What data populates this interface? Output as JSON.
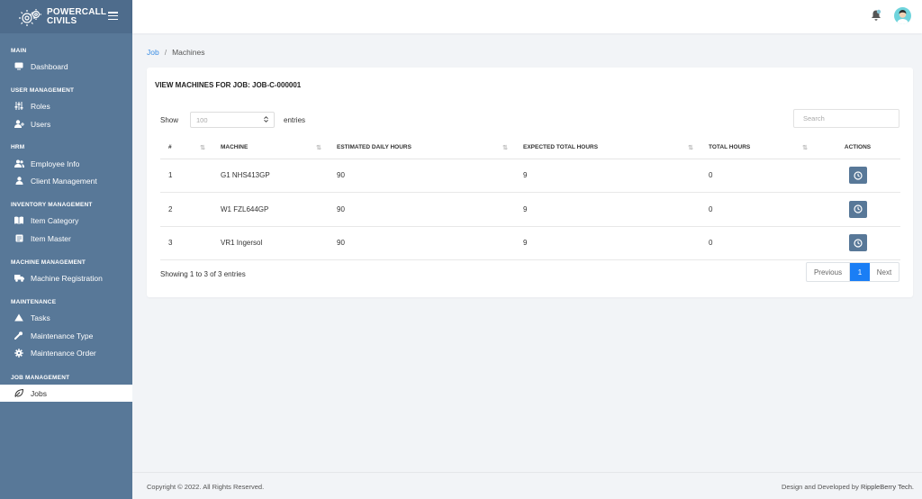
{
  "brand": {
    "line1": "POWERCALL",
    "line2": "CIVILS"
  },
  "sidebar": {
    "sections": [
      {
        "title": "MAIN",
        "items": [
          {
            "label": "Dashboard",
            "icon": "monitor-icon"
          }
        ]
      },
      {
        "title": "USER MANAGEMENT",
        "items": [
          {
            "label": "Roles",
            "icon": "sliders-icon"
          },
          {
            "label": "Users",
            "icon": "user-plus-icon"
          }
        ]
      },
      {
        "title": "HRM",
        "items": [
          {
            "label": "Employee Info",
            "icon": "users-icon"
          },
          {
            "label": "Client Management",
            "icon": "user-icon"
          }
        ]
      },
      {
        "title": "INVENTORY MANAGEMENT",
        "items": [
          {
            "label": "Item Category",
            "icon": "book-icon"
          },
          {
            "label": "Item Master",
            "icon": "list-icon"
          }
        ]
      },
      {
        "title": "MACHINE MANAGEMENT",
        "items": [
          {
            "label": "Machine Registration",
            "icon": "truck-icon"
          }
        ]
      },
      {
        "title": "MAINTENANCE",
        "items": [
          {
            "label": "Tasks",
            "icon": "triangle-icon"
          },
          {
            "label": "Maintenance Type",
            "icon": "wrench-icon"
          },
          {
            "label": "Maintenance Order",
            "icon": "gear-icon"
          }
        ]
      },
      {
        "title": "JOB MANAGEMENT",
        "items": [
          {
            "label": "Jobs",
            "icon": "leaf-icon",
            "active": true
          }
        ]
      }
    ]
  },
  "breadcrumb": {
    "link": "Job",
    "separator": "/",
    "current": "Machines"
  },
  "card": {
    "title": "VIEW MACHINES FOR JOB: JOB-C-000001",
    "show_label": "Show",
    "entries_value": "100",
    "entries_label": "entries",
    "search_placeholder": "Search"
  },
  "table": {
    "columns": [
      "#",
      "MACHINE",
      "ESTIMATED DAILY HOURS",
      "EXPECTED TOTAL HOURS",
      "TOTAL HOURS",
      "ACTIONS"
    ],
    "rows": [
      [
        "1",
        "G1 NHS413GP",
        "90",
        "9",
        "0"
      ],
      [
        "2",
        "W1 FZL644GP",
        "90",
        "9",
        "0"
      ],
      [
        "3",
        "VR1 Ingersol",
        "90",
        "9",
        "0"
      ]
    ]
  },
  "info": "Showing 1 to 3 of 3 entries",
  "pager": {
    "prev": "Previous",
    "current": "1",
    "next": "Next"
  },
  "footer": {
    "copyright": "Copyright © 2022. All Rights Reserved.",
    "credit_prefix": "Design and Developed by",
    "credit_name": "RippleBerry Tech."
  },
  "colors": {
    "sidebar": "#587898",
    "accent": "#1a7ef5",
    "action_button": "#587898"
  }
}
